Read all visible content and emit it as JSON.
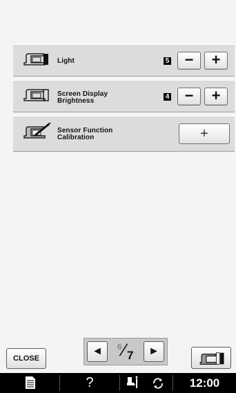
{
  "settings": [
    {
      "label_line1": "Light",
      "label_line2": "",
      "value": "5",
      "minus": "−",
      "plus": "+"
    },
    {
      "label_line1": "Screen Display",
      "label_line2": "Brightness",
      "value": "4",
      "minus": "−",
      "plus": "+"
    },
    {
      "label_line1": "Sensor Function",
      "label_line2": "Calibration",
      "action": "+"
    }
  ],
  "footer": {
    "close_label": "CLOSE",
    "prev_icon": "◄",
    "next_icon": "►",
    "page_current": "6",
    "page_total": "7"
  },
  "taskbar": {
    "doc_icon": "document-icon",
    "help_label": "?",
    "time": "12:00"
  },
  "colors": {
    "background": "#f4f4f4",
    "row": "#dcdcdc",
    "taskbar": "#000000"
  }
}
